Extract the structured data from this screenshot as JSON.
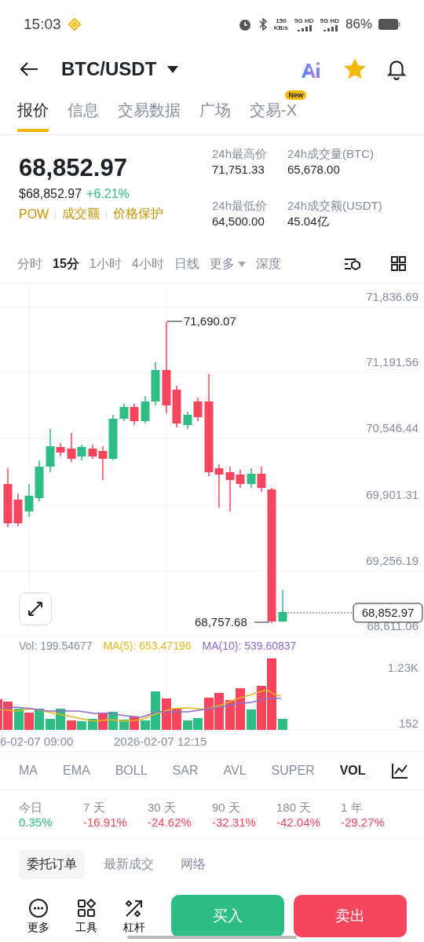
{
  "status_bar": {
    "time": "15:03",
    "speed": "150",
    "speed_unit": "KB/s",
    "networks": [
      "5G HD",
      "5G HD"
    ],
    "battery": "86%"
  },
  "header": {
    "pair": "BTC/USDT",
    "favorite": true
  },
  "tabs": [
    {
      "label": "报价",
      "selected": true
    },
    {
      "label": "信息",
      "selected": false
    },
    {
      "label": "交易数据",
      "selected": false
    },
    {
      "label": "广场",
      "selected": false
    },
    {
      "label": "交易-X",
      "selected": false,
      "badge": "New"
    }
  ],
  "price": {
    "last": "68,852.97",
    "usd": "$68,852.97",
    "change": "+6.21%",
    "tags": [
      "POW",
      "成交额",
      "价格保护"
    ]
  },
  "stats": [
    {
      "label": "24h最高价",
      "value": "71,751.33"
    },
    {
      "label": "24h成交量(BTC)",
      "value": "65,678.00"
    },
    {
      "label": "24h最低价",
      "value": "64,500.00"
    },
    {
      "label": "24h成交额(USDT)",
      "value": "45.04亿"
    }
  ],
  "intervals": [
    {
      "label": "分时",
      "selected": false,
      "kind": "option"
    },
    {
      "label": "15分",
      "selected": true,
      "kind": "option"
    },
    {
      "label": "1小时",
      "selected": false,
      "kind": "option"
    },
    {
      "label": "4小时",
      "selected": false,
      "kind": "option"
    },
    {
      "label": "日线",
      "selected": false,
      "kind": "option"
    },
    {
      "label": "更多",
      "selected": false,
      "kind": "dropdown"
    },
    {
      "label": "深度",
      "selected": false,
      "kind": "option"
    }
  ],
  "chart": {
    "price_ticks": [
      "71,836.69",
      "71,191.56",
      "70,546.44",
      "69,901.31",
      "69,256.19",
      "68,611.06"
    ],
    "high_label": "71,690.07",
    "low_label": "68,757.68",
    "current_price": "68,852.97"
  },
  "volume": {
    "vol": "Vol: 199.54677",
    "ma5": "MA(5): 653.47196",
    "ma10": "MA(10): 539.60837",
    "ticks": [
      "1.23K",
      "152"
    ],
    "dates": [
      "6-02-07 09:00",
      "2026-02-07 12:15"
    ]
  },
  "indicators": [
    {
      "label": "MA",
      "selected": false
    },
    {
      "label": "EMA",
      "selected": false
    },
    {
      "label": "BOLL",
      "selected": false
    },
    {
      "label": "SAR",
      "selected": false
    },
    {
      "label": "AVL",
      "selected": false
    },
    {
      "label": "SUPER",
      "selected": false
    },
    {
      "label": "VOL",
      "selected": true
    }
  ],
  "performance": [
    {
      "period": "今日",
      "change": "0.35%"
    },
    {
      "period": "7 天",
      "change": "-16.91%"
    },
    {
      "period": "30 天",
      "change": "-24.62%"
    },
    {
      "period": "90 天",
      "change": "-32.31%"
    },
    {
      "period": "180 天",
      "change": "-42.04%"
    },
    {
      "period": "1 年",
      "change": "-29.27%"
    }
  ],
  "order_tabs": [
    {
      "label": "委托订单",
      "selected": true
    },
    {
      "label": "最新成交",
      "selected": false
    },
    {
      "label": "网络",
      "selected": false
    }
  ],
  "tools": [
    {
      "label": "更多",
      "kind": "more"
    },
    {
      "label": "工具",
      "kind": "tools"
    },
    {
      "label": "杠杆",
      "kind": "leverage"
    }
  ],
  "buy": "买入",
  "sell": "卖出"
}
